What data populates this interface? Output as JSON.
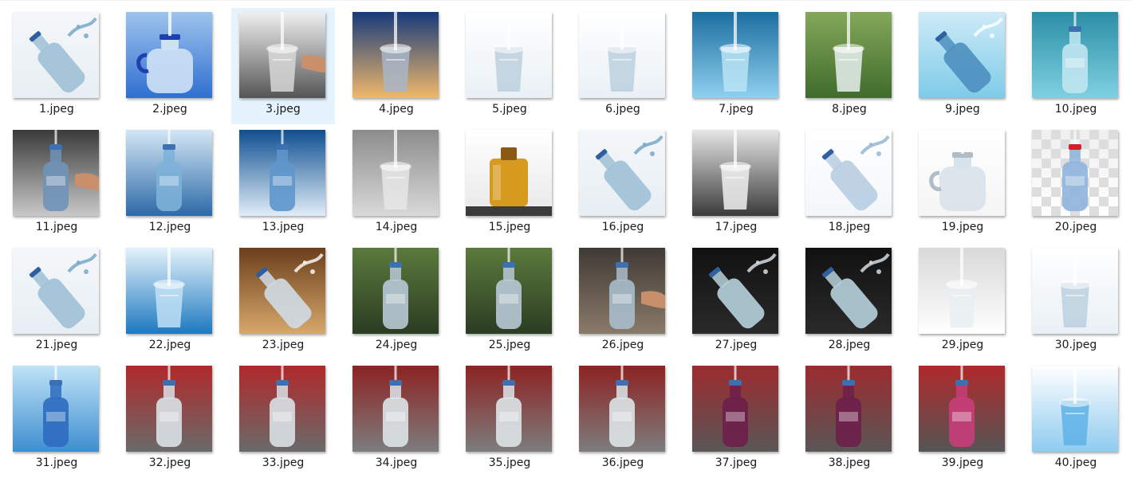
{
  "window": {
    "view": "large-icons"
  },
  "selected_index": 2,
  "files": [
    {
      "name": "1.jpeg",
      "theme": "white-splash-bottle"
    },
    {
      "name": "2.jpeg",
      "theme": "blue-jug"
    },
    {
      "name": "3.jpeg",
      "theme": "hand-glass-gray"
    },
    {
      "name": "4.jpeg",
      "theme": "sunset-pour"
    },
    {
      "name": "5.jpeg",
      "theme": "white-glass"
    },
    {
      "name": "6.jpeg",
      "theme": "white-glass"
    },
    {
      "name": "7.jpeg",
      "theme": "blue-glass-splash"
    },
    {
      "name": "8.jpeg",
      "theme": "green-pour"
    },
    {
      "name": "9.jpeg",
      "theme": "sky-bottle-splash"
    },
    {
      "name": "10.jpeg",
      "theme": "teal-bottle-splash"
    },
    {
      "name": "11.jpeg",
      "theme": "dark-bottle-hand"
    },
    {
      "name": "12.jpeg",
      "theme": "blue-bottle-splash"
    },
    {
      "name": "13.jpeg",
      "theme": "blue-bottle"
    },
    {
      "name": "14.jpeg",
      "theme": "gray-tap"
    },
    {
      "name": "15.jpeg",
      "theme": "amber-jar"
    },
    {
      "name": "16.jpeg",
      "theme": "white-splash-bottle"
    },
    {
      "name": "17.jpeg",
      "theme": "gray-glass"
    },
    {
      "name": "18.jpeg",
      "theme": "white-pour-bottle"
    },
    {
      "name": "19.jpeg",
      "theme": "white-pour-jug"
    },
    {
      "name": "20.jpeg",
      "theme": "checker-bottle"
    },
    {
      "name": "21.jpeg",
      "theme": "white-splash-bottle"
    },
    {
      "name": "22.jpeg",
      "theme": "blue-glass-pour"
    },
    {
      "name": "23.jpeg",
      "theme": "brown-tap-bottle"
    },
    {
      "name": "24.jpeg",
      "theme": "green-bottle"
    },
    {
      "name": "25.jpeg",
      "theme": "green-bottle"
    },
    {
      "name": "26.jpeg",
      "theme": "dark-splash-hand"
    },
    {
      "name": "27.jpeg",
      "theme": "black-bottle-splash"
    },
    {
      "name": "28.jpeg",
      "theme": "black-bottle-splash"
    },
    {
      "name": "29.jpeg",
      "theme": "split-pour"
    },
    {
      "name": "30.jpeg",
      "theme": "white-glass"
    },
    {
      "name": "31.jpeg",
      "theme": "sky-bottle-up"
    },
    {
      "name": "32.jpeg",
      "theme": "red-bottle"
    },
    {
      "name": "33.jpeg",
      "theme": "red-bottle"
    },
    {
      "name": "34.jpeg",
      "theme": "red-basin-bottle"
    },
    {
      "name": "35.jpeg",
      "theme": "red-basin-bottle"
    },
    {
      "name": "36.jpeg",
      "theme": "red-basin-bottle"
    },
    {
      "name": "37.jpeg",
      "theme": "purple-bottle"
    },
    {
      "name": "38.jpeg",
      "theme": "purple-bottle"
    },
    {
      "name": "39.jpeg",
      "theme": "red-pink-bottle"
    },
    {
      "name": "40.jpeg",
      "theme": "white-blue-glass"
    }
  ],
  "colors": {
    "selection": "#cce8ff",
    "hover": "#e5f3ff",
    "text": "#1a1a1a"
  }
}
